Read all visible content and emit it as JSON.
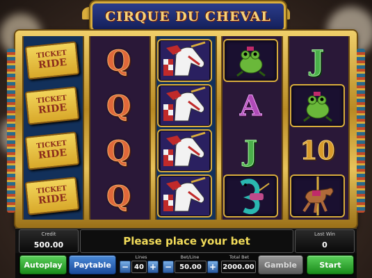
{
  "game": {
    "title": "CIRQUE DU CHEVAL"
  },
  "reels": [
    {
      "symbols": [
        {
          "type": "ticket",
          "line1": "TICKET",
          "line2": "RIDE"
        },
        {
          "type": "ticket",
          "line1": "TICKET",
          "line2": "RIDE"
        },
        {
          "type": "ticket",
          "line1": "TICKET",
          "line2": "RIDE"
        },
        {
          "type": "ticket",
          "line1": "TICKET",
          "line2": "RIDE"
        }
      ]
    },
    {
      "symbols": [
        {
          "type": "card",
          "label": "Q"
        },
        {
          "type": "card",
          "label": "Q"
        },
        {
          "type": "card",
          "label": "Q"
        },
        {
          "type": "card",
          "label": "Q"
        }
      ]
    },
    {
      "symbols": [
        {
          "type": "horse-head"
        },
        {
          "type": "horse-head"
        },
        {
          "type": "horse-head"
        },
        {
          "type": "horse-head"
        }
      ]
    },
    {
      "symbols": [
        {
          "type": "frog"
        },
        {
          "type": "card",
          "label": "A"
        },
        {
          "type": "card",
          "label": "J"
        },
        {
          "type": "seahorse"
        }
      ]
    },
    {
      "symbols": [
        {
          "type": "card",
          "label": "J"
        },
        {
          "type": "frog"
        },
        {
          "type": "card",
          "label": "10"
        },
        {
          "type": "carousel-horse"
        }
      ]
    }
  ],
  "info": {
    "credit_label": "Credit",
    "credit_value": "500.00",
    "message": "Please place your bet",
    "last_win_label": "Last Win",
    "last_win_value": "0"
  },
  "controls": {
    "autoplay": "Autoplay",
    "paytable": "Paytable",
    "lines_label": "Lines",
    "lines_value": "40",
    "bet_line_label": "Bet/Line",
    "bet_line_value": "50.00",
    "total_bet_label": "Total Bet",
    "total_bet_value": "2000.00",
    "gamble": "Gamble",
    "start": "Start",
    "minus": "−",
    "plus": "+"
  },
  "colors": {
    "frame_gold": "#d9ad3c",
    "message_yellow": "#f2dc5a",
    "button_green": "#2a9a2a",
    "button_blue": "#2a5ab0"
  }
}
